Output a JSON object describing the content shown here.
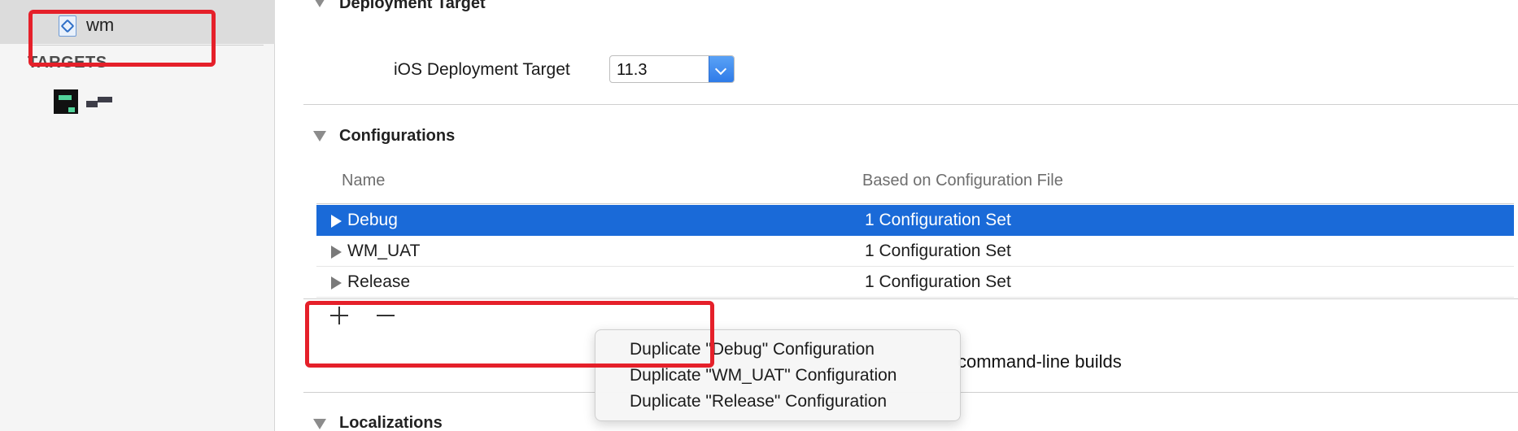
{
  "sidebar": {
    "project_label": "wm",
    "targets_header": "TARGETS"
  },
  "sections": {
    "deployment_title": "Deployment Target",
    "deployment_field_label": "iOS Deployment Target",
    "deployment_value": "11.3",
    "configurations_title": "Configurations",
    "localizations_title": "Localizations"
  },
  "configurations": {
    "headers": {
      "name": "Name",
      "based_on": "Based on Configuration File"
    },
    "rows": [
      {
        "name": "Debug",
        "based_on": "1 Configuration Set",
        "selected": true
      },
      {
        "name": "WM_UAT",
        "based_on": "1 Configuration Set",
        "selected": false
      },
      {
        "name": "Release",
        "based_on": "1 Configuration Set",
        "selected": false
      }
    ],
    "behind_text": "command-line builds"
  },
  "menu": {
    "items": [
      "Duplicate \"Debug\" Configuration",
      "Duplicate \"WM_UAT\" Configuration",
      "Duplicate \"Release\" Configuration"
    ]
  },
  "colors": {
    "selection": "#1a6ad8",
    "annotation": "#e5202a",
    "popup_accent": "#2f7be8"
  },
  "icons": {
    "project": "project-file-icon",
    "target": "app-target-icon",
    "add": "plus-icon",
    "remove": "minus-icon",
    "disclosure": "disclosure-triangle-icon",
    "popup": "chevron-down-icon"
  }
}
